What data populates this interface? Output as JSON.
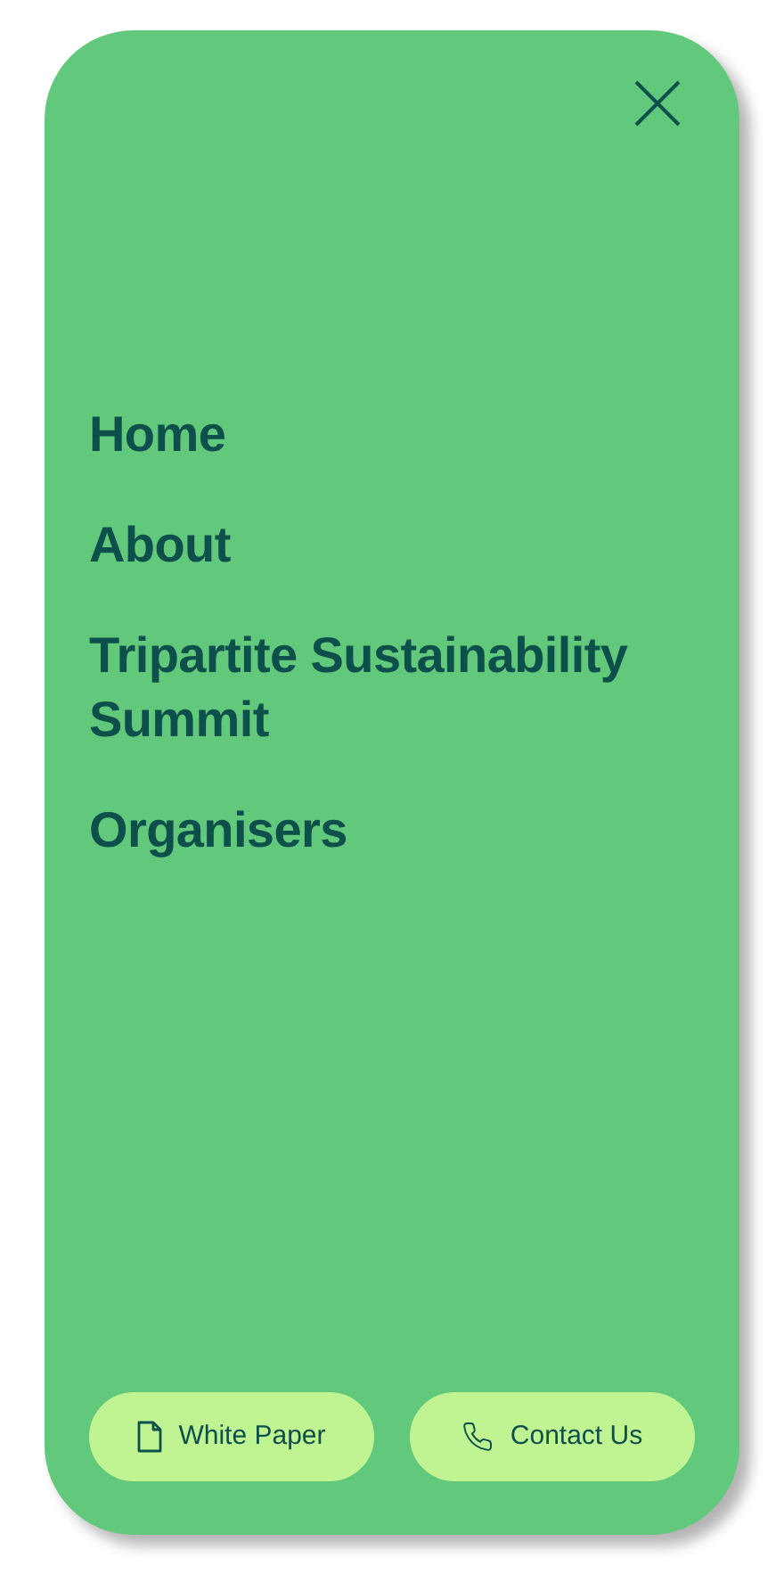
{
  "nav_items": [
    {
      "label": "Home"
    },
    {
      "label": "About"
    },
    {
      "label": "Tripartite Sustainability Summit"
    },
    {
      "label": "Organisers"
    }
  ],
  "buttons": [
    {
      "label": "White Paper",
      "kind": "document"
    },
    {
      "label": "Contact Us",
      "kind": "phone"
    }
  ]
}
